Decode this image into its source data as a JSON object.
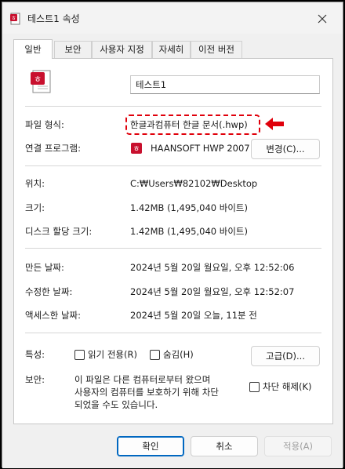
{
  "window": {
    "title": "테스트1 속성",
    "accent_color": "#0067c0",
    "annotation_color": "#e0000b"
  },
  "tabs": [
    {
      "label": "일반",
      "active": true
    },
    {
      "label": "보안"
    },
    {
      "label": "사용자 지정"
    },
    {
      "label": "자세히"
    },
    {
      "label": "이전 버전"
    }
  ],
  "general": {
    "file_name": "테스트1",
    "file_type": {
      "label": "파일 형식:",
      "value": "한글과컴퓨터 한글 문서(.hwp)"
    },
    "open_with": {
      "label": "연결 프로그램:",
      "value": "HAANSOFT HWP 2007",
      "change_button": "변경(C)..."
    },
    "location": {
      "label": "위치:",
      "value": "C:₩Users₩82102₩Desktop"
    },
    "size": {
      "label": "크기:",
      "value": "1.42MB (1,495,040 바이트)"
    },
    "size_on_disk": {
      "label": "디스크 할당 크기:",
      "value": "1.42MB (1,495,040 바이트)"
    },
    "created": {
      "label": "만든 날짜:",
      "value": "2024년 5월 20일 월요일, 오후 12:52:06"
    },
    "modified": {
      "label": "수정한 날짜:",
      "value": "2024년 5월 20일 월요일, 오후 12:52:07"
    },
    "accessed": {
      "label": "액세스한 날짜:",
      "value": "2024년 5월 20일 오늘, 11분 전"
    },
    "attributes": {
      "label": "특성:",
      "readonly": "읽기 전용(R)",
      "hidden": "숨김(H)",
      "advanced_button": "고급(D)..."
    },
    "security": {
      "label": "보안:",
      "lines": [
        "이 파일은 다른 컴퓨터로부터 왔으며",
        "사용자의 컴퓨터를 보호하기 위해 차단",
        "되었을 수도 있습니다."
      ],
      "unblock": "차단 해제(K)"
    }
  },
  "footer": {
    "ok": "확인",
    "cancel": "취소",
    "apply": "적용(A)"
  }
}
